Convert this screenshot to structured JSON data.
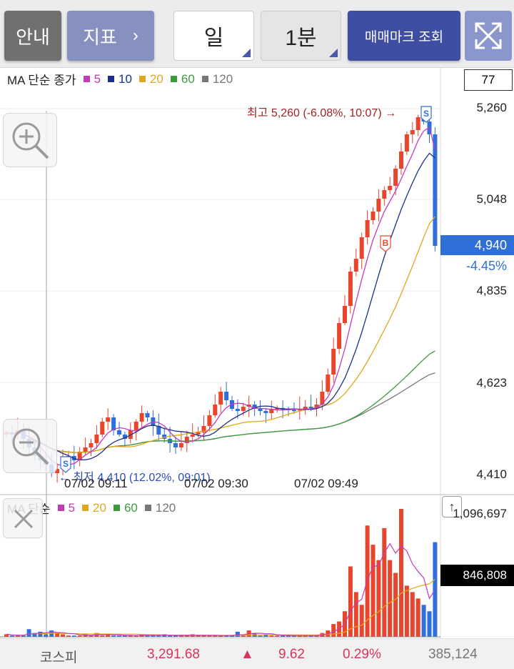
{
  "toolbar": {
    "guide": "안내",
    "indicator": "지표",
    "indicator_chevron": "›",
    "period": "일",
    "interval": "1분",
    "trade_mark": "매매마크 조회"
  },
  "legend_main": {
    "prefix": "MA 단순 종가",
    "items": [
      {
        "label": "5",
        "color": "#c23bb8"
      },
      {
        "label": "10",
        "color": "#1c2f8c"
      },
      {
        "label": "20",
        "color": "#e0a81c"
      },
      {
        "label": "60",
        "color": "#3e9a3e"
      },
      {
        "label": "120",
        "color": "#777777"
      }
    ]
  },
  "legend_volume": {
    "prefix": "MA 단순",
    "items": [
      {
        "label": "5",
        "color": "#c23bb8"
      },
      {
        "label": "20",
        "color": "#e0a81c"
      },
      {
        "label": "60",
        "color": "#3e9a3e"
      },
      {
        "label": "120",
        "color": "#777777"
      }
    ]
  },
  "count_box": "77",
  "price_axis": [
    "5,260",
    "5,048",
    "4,835",
    "4,623",
    "4,410"
  ],
  "current_price": "4,940",
  "current_change": "-4.45%",
  "high_annotation": "최고 5,260 (-6.08%, 10:07) →",
  "low_annotation": "← 최저 4,410 (12.02%, 09:01)",
  "time_labels": [
    "07/02 09:11",
    "07/02 09:30",
    "07/02 09:49"
  ],
  "volume_axis_top": "1,096,697",
  "volume_current": "846,808",
  "buy_mark": "B",
  "sell_mark": "S",
  "scroll_up": "↑",
  "bottom": {
    "index_name": "코스피",
    "index_value": "3,291.68",
    "arrow": "▲",
    "change": "9.62",
    "change_pct": "0.29%",
    "volume": "385,124"
  },
  "colors": {
    "up": "#e8452c",
    "down": "#2f6fd8",
    "accent": "#3e4fa3"
  },
  "chart_data": {
    "type": "candlestick",
    "price_range": [
      4410,
      5260
    ],
    "current_price": 4940,
    "high": {
      "value": 5260,
      "time": "10:07",
      "pct": "-6.08%"
    },
    "low": {
      "value": 4410,
      "time": "09:01",
      "pct": "12.02%"
    }
  }
}
